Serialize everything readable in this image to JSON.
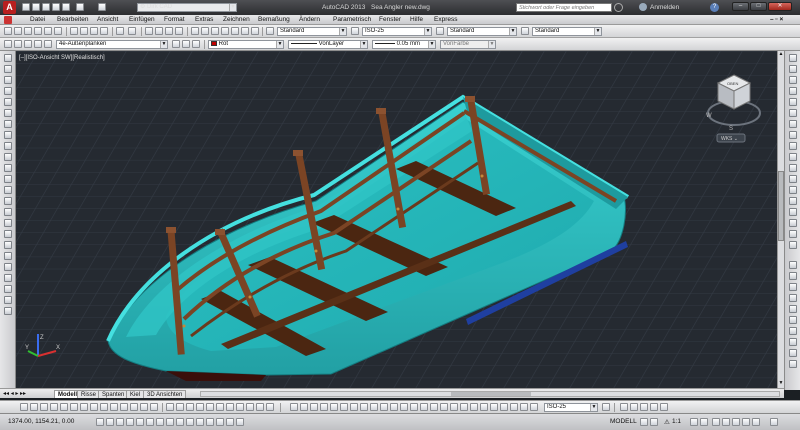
{
  "title_bar": {
    "app_title": "AutoCAD 2013",
    "file_title": "Sea Angler new.dwg",
    "workspace": "Dirk CAD",
    "search_placeholder": "Stichwort oder Frage eingeben",
    "signin_label": "Anmelden",
    "minimize_label": "–",
    "maximize_label": "□",
    "close_label": "✕"
  },
  "menu": [
    "Datei",
    "Bearbeiten",
    "Ansicht",
    "Einfügen",
    "Format",
    "Extras",
    "Zeichnen",
    "Bemaßung",
    "Ändern",
    "Parametrisch",
    "Fenster",
    "Hilfe",
    "Express"
  ],
  "toolbar_styles": {
    "text_style": "Standard",
    "dim_style": "ISO-25",
    "table_style": "Standard",
    "multileader_style": "Standard"
  },
  "toolbar_layers": {
    "layer": "4e-Außenplanken",
    "color": "Rot",
    "color_hex": "#c00000",
    "linetype": "VonLayer",
    "lineweight": "0.05 mm",
    "plotstyle": "VonFarbe"
  },
  "viewport": {
    "label": "[–][ISO-Ansicht SW][Realistisch]",
    "viewcube_top": "OBEN",
    "viewcube_compass_w": "W",
    "viewcube_compass_s": "S",
    "wcs_label": "WKS ⌄",
    "ucs_x": "X",
    "ucs_y": "Y",
    "ucs_z": "Z",
    "colors": {
      "background": "#252a31",
      "grid": "#343b45",
      "hull": "#2ab3b5",
      "hull_light": "#38d1d1",
      "wood": "#7b4424",
      "wood_dark": "#4b2611",
      "stripe": "#1f3fa0"
    }
  },
  "tabs": [
    "Modell",
    "Risse",
    "Spanten",
    "Kiel",
    "3D Ansichten"
  ],
  "bottom_toolbar": {
    "dim_style": "ISO-25"
  },
  "status": {
    "coords": "1374.00, 1154.21, 0.00",
    "space": "MODELL",
    "scale": "1:1"
  }
}
